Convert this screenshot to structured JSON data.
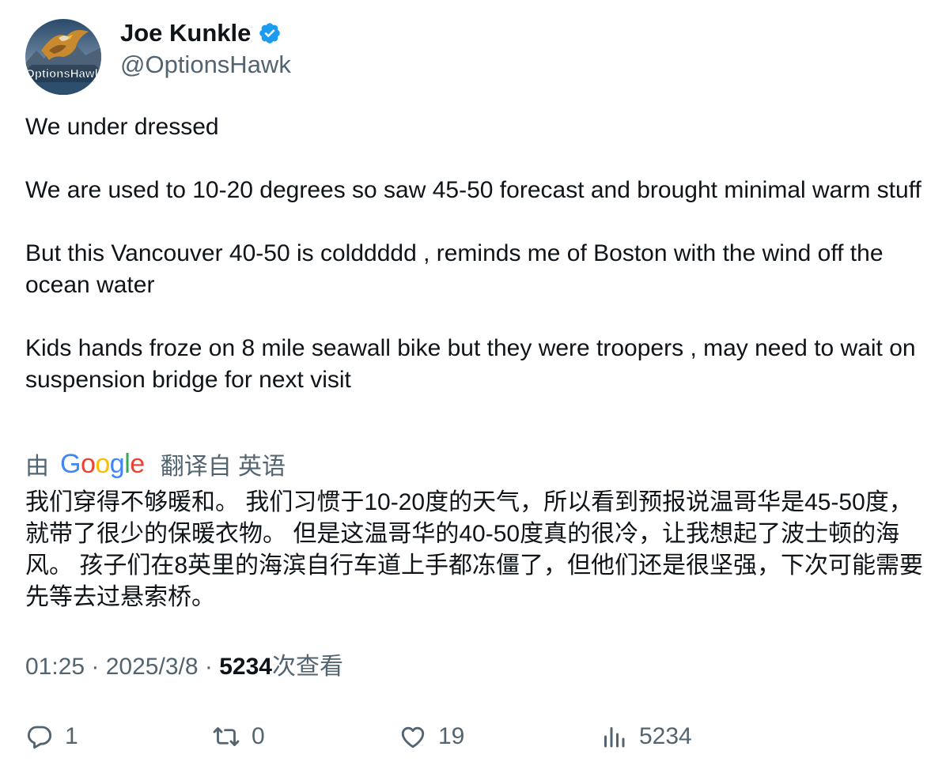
{
  "author": {
    "display_name": "Joe Kunkle",
    "handle": "@OptionsHawk",
    "verified": true,
    "avatar_icon": "hawk-logo-avatar",
    "avatar_text": "OptionsHawk"
  },
  "tweet": {
    "paragraphs": [
      "We under dressed",
      "We are used to 10-20 degrees so saw 45-50 forecast and brought minimal warm stuff",
      "But this Vancouver 40-50 is colddddd , reminds me of Boston with the wind off the ocean water",
      "Kids hands froze on 8 mile seawall bike but they were troopers , may need to wait on suspension bridge for next visit"
    ]
  },
  "translation": {
    "by_label": "由",
    "provider": "Google",
    "from_label": "翻译自 英语",
    "text": "我们穿得不够暖和。 我们习惯于10-20度的天气，所以看到预报说温哥华是45-50度，就带了很少的保暖衣物。 但是这温哥华的40-50度真的很冷，让我想起了波士顿的海风。 孩子们在8英里的海滨自行车道上手都冻僵了，但他们还是很坚强，下次可能需要先等去过悬索桥。"
  },
  "meta": {
    "time": "01:25",
    "separator": " · ",
    "date": "2025/3/8",
    "views_count": "5234",
    "views_label": "次查看"
  },
  "actions": {
    "replies": "1",
    "retweets": "0",
    "likes": "19",
    "views": "5234"
  },
  "colors": {
    "text_primary": "#0f1419",
    "text_secondary": "#536471",
    "verified_blue": "#1d9bf0"
  }
}
